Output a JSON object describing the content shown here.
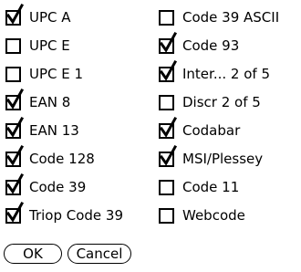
{
  "barcodes": [
    {
      "label": "UPC A",
      "checked": true
    },
    {
      "label": "Code 39 ASCII",
      "checked": false
    },
    {
      "label": "UPC E",
      "checked": false
    },
    {
      "label": "Code 93",
      "checked": true
    },
    {
      "label": "UPC E 1",
      "checked": false
    },
    {
      "label": "Inter... 2 of 5",
      "checked": true
    },
    {
      "label": "EAN 8",
      "checked": true
    },
    {
      "label": "Discr 2 of 5",
      "checked": false
    },
    {
      "label": "EAN 13",
      "checked": true
    },
    {
      "label": "Codabar",
      "checked": true
    },
    {
      "label": "Code 128",
      "checked": true
    },
    {
      "label": "MSI/Plessey",
      "checked": true
    },
    {
      "label": "Code 39",
      "checked": true
    },
    {
      "label": "Code 11",
      "checked": false
    },
    {
      "label": "Triop Code 39",
      "checked": true
    },
    {
      "label": "Webcode",
      "checked": false
    }
  ],
  "buttons": {
    "ok": "OK",
    "cancel": "Cancel"
  },
  "icons": {
    "checked": "checkmark-icon"
  }
}
